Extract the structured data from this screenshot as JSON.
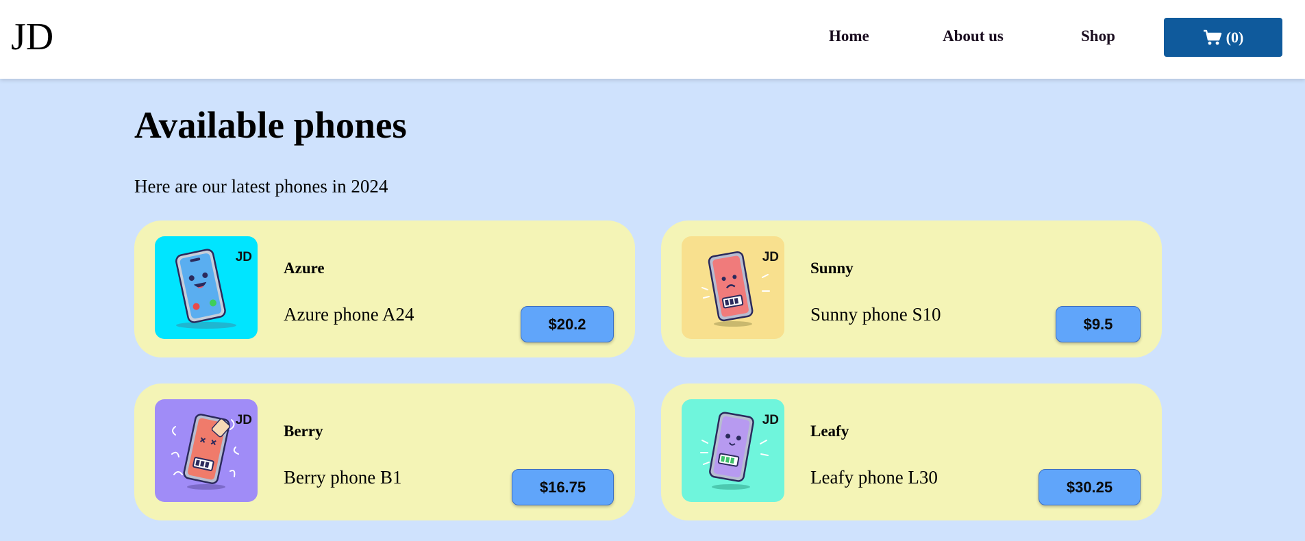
{
  "navbar": {
    "brand": "JD",
    "links": [
      "Home",
      "About us",
      "Shop"
    ],
    "cart_label": "(0)"
  },
  "main": {
    "title": "Available phones",
    "subtitle": "Here are our latest phones in 2024"
  },
  "products": [
    {
      "name": "Azure",
      "description": "Azure phone A24",
      "price": "$20.2",
      "logo": "JD",
      "thumb_color": "#00e5ff",
      "phone_color": "#5aaef0",
      "mood": "happy"
    },
    {
      "name": "Sunny",
      "description": "Sunny phone S10",
      "price": "$9.5",
      "logo": "JD",
      "thumb_color": "#f8e08e",
      "phone_color": "#f07b7b",
      "mood": "sad"
    },
    {
      "name": "Berry",
      "description": "Berry phone B1",
      "price": "$16.75",
      "logo": "JD",
      "thumb_color": "#a08cf7",
      "phone_color": "#f07b6b",
      "mood": "dizzy"
    },
    {
      "name": "Leafy",
      "description": "Leafy phone L30",
      "price": "$30.25",
      "logo": "JD",
      "thumb_color": "#6ff5dc",
      "phone_color": "#b79af0",
      "mood": "happy"
    }
  ]
}
